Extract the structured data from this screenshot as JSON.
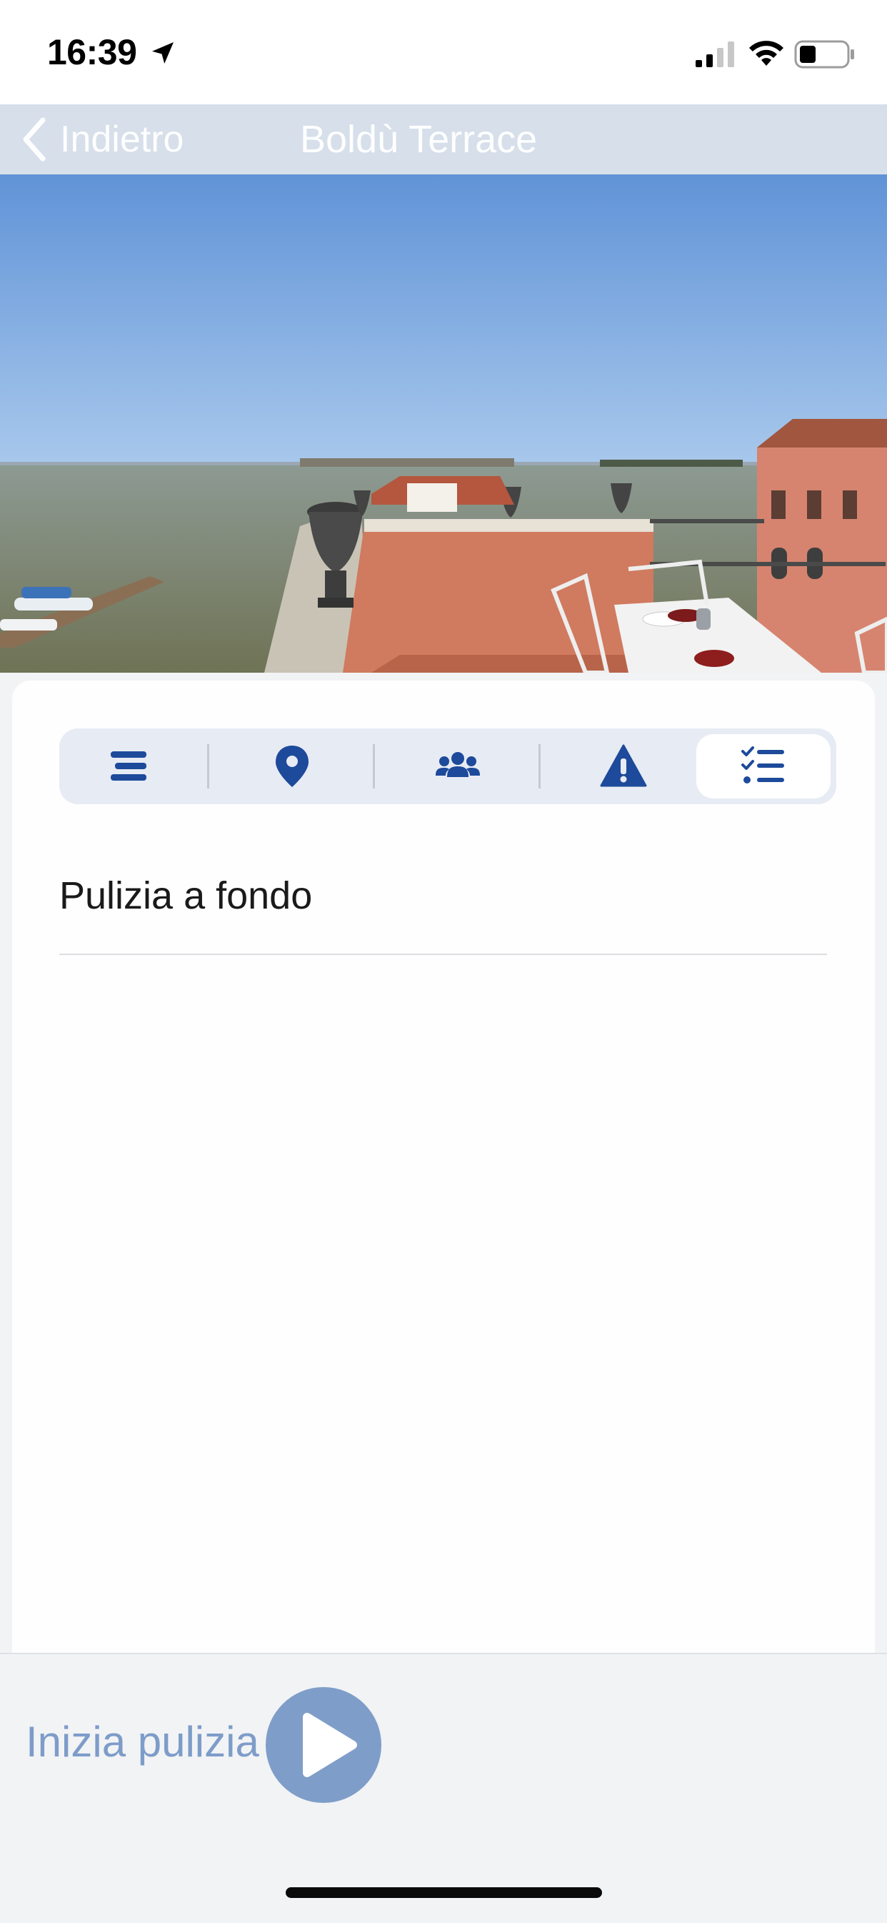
{
  "status_bar": {
    "time": "16:39",
    "icons": [
      "location-arrow-icon",
      "signal-icon",
      "wifi-icon",
      "battery-icon"
    ]
  },
  "nav": {
    "back_label": "Indietro",
    "title": "Boldù Terrace"
  },
  "hero": {
    "image": "venice-rooftop-terrace-lagoon-photo"
  },
  "tabs": [
    {
      "name": "description",
      "icon": "align-lines-icon",
      "active": false
    },
    {
      "name": "location",
      "icon": "map-pin-icon",
      "active": false
    },
    {
      "name": "guests",
      "icon": "users-icon",
      "active": false
    },
    {
      "name": "issues",
      "icon": "warning-icon",
      "active": false
    },
    {
      "name": "checklist",
      "icon": "checklist-icon",
      "active": true
    }
  ],
  "task": {
    "label": "Pulizia a fondo"
  },
  "action": {
    "start_label": "Inizia pulizia",
    "button_icon": "play-icon"
  },
  "colors": {
    "accent": "#1d4a9a",
    "tab_background": "#e7ebf4",
    "action_muted": "#7f9dc9",
    "sky_top": "#5b8ed4",
    "water": "#8a8f78",
    "terracotta": "#d07a5f"
  }
}
